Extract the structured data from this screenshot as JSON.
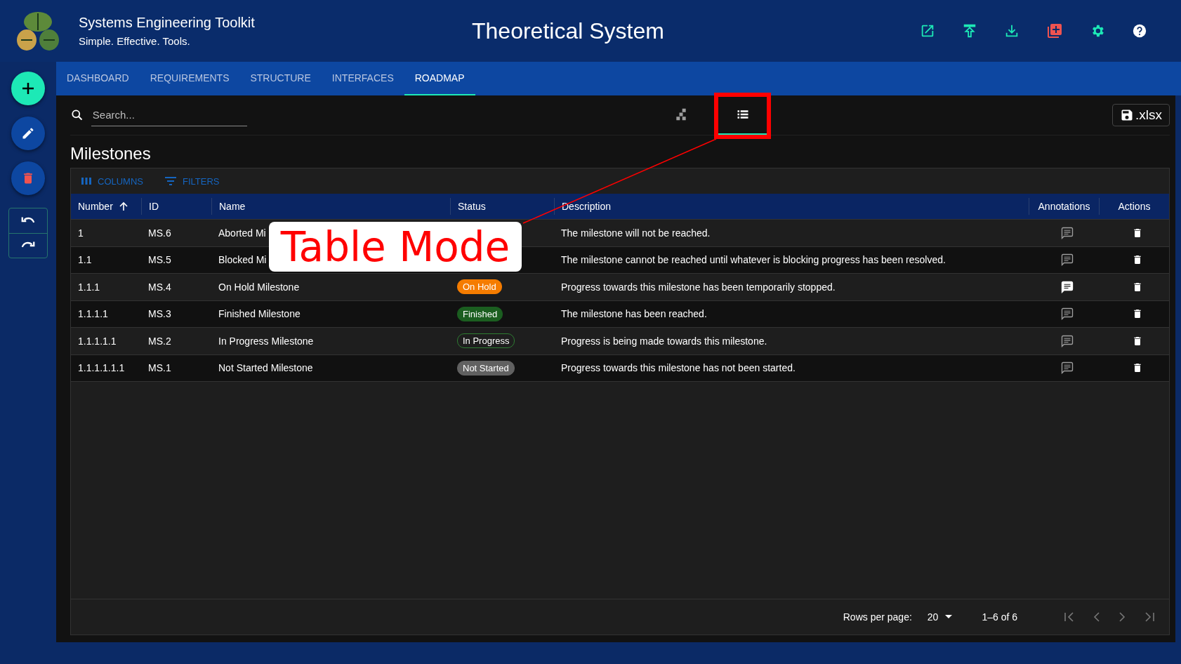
{
  "app": {
    "name": "Systems Engineering Toolkit",
    "tagline": "Simple. Effective. Tools."
  },
  "window": {
    "title": "Theoretical System"
  },
  "tabs": [
    {
      "label": "DASHBOARD",
      "selected": false
    },
    {
      "label": "REQUIREMENTS",
      "selected": false
    },
    {
      "label": "STRUCTURE",
      "selected": false
    },
    {
      "label": "INTERFACES",
      "selected": false
    },
    {
      "label": "ROADMAP",
      "selected": true
    }
  ],
  "search": {
    "placeholder": "Search..."
  },
  "view_modes": [
    {
      "kind": "diagram",
      "selected": false
    },
    {
      "kind": "table",
      "selected": true
    }
  ],
  "export_button": {
    "label": ".xlsx"
  },
  "section_title": "Milestones",
  "table_toolbar": [
    {
      "kind": "columns",
      "label": "COLUMNS"
    },
    {
      "kind": "filters",
      "label": "FILTERS"
    }
  ],
  "table": {
    "columns": [
      {
        "label": "Number",
        "sorted": true
      },
      {
        "label": "ID"
      },
      {
        "label": "Name"
      },
      {
        "label": "Status"
      },
      {
        "label": "Description"
      },
      {
        "label": "Annotations"
      },
      {
        "label": "Actions"
      }
    ],
    "rows": [
      {
        "number": "1",
        "id": "MS.6",
        "name": "Aborted Mi",
        "description": "The milestone will not be reached.",
        "has_annotations": false
      },
      {
        "number": "1.1",
        "id": "MS.5",
        "name": "Blocked Mi",
        "description": "The milestone cannot be reached until whatever is blocking progress has been resolved.",
        "has_annotations": false
      },
      {
        "number": "1.1.1",
        "id": "MS.4",
        "name": "On Hold Milestone",
        "status": {
          "label": "On Hold",
          "color": "#f57c00",
          "outlined": false
        },
        "description": "Progress towards this milestone has been temporarily stopped.",
        "has_annotations": true
      },
      {
        "number": "1.1.1.1",
        "id": "MS.3",
        "name": "Finished Milestone",
        "status": {
          "label": "Finished",
          "color": "#1b5e20",
          "outlined": false
        },
        "description": "The milestone has been reached.",
        "has_annotations": false
      },
      {
        "number": "1.1.1.1.1",
        "id": "MS.2",
        "name": "In Progress Milestone",
        "status": {
          "label": "In Progress",
          "color": "#2e7d32",
          "outlined": true
        },
        "description": "Progress is being made towards this milestone.",
        "has_annotations": false
      },
      {
        "number": "1.1.1.1.1.1",
        "id": "MS.1",
        "name": "Not Started Milestone",
        "status": {
          "label": "Not Started",
          "color": "#616161",
          "outlined": false
        },
        "description": "Progress towards this milestone has not been started.",
        "has_annotations": false
      }
    ]
  },
  "pagination": {
    "rows_per_page_label": "Rows per page:",
    "rows_per_page": "20",
    "range": "1–6 of 6"
  },
  "callout": {
    "text": "Table Mode"
  }
}
